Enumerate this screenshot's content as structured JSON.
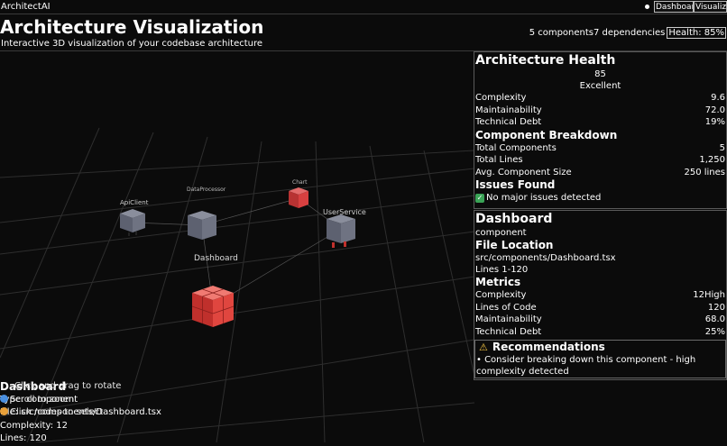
{
  "app": {
    "title": "ArchitectAI"
  },
  "topbar": {
    "dashboard_label": "Dashboard",
    "visualize_label": "Visualize"
  },
  "header": {
    "title": "Architecture Visualization",
    "subtitle": "Interactive 3D visualization of your codebase architecture",
    "components_text": "5 components",
    "dependencies_text": "7 dependencies",
    "health_badge": "Health: 85%"
  },
  "scene": {
    "nodes": [
      {
        "label": "ApiClient",
        "color": "#6f7382"
      },
      {
        "label": "DataProcessor",
        "color": "#6f7382"
      },
      {
        "label": "Chart",
        "color": "#d84040"
      },
      {
        "label": "UserService",
        "color": "#6f7382"
      },
      {
        "label": "Dashboard",
        "color": "#e0463f"
      }
    ]
  },
  "health": {
    "title": "Architecture Health",
    "score": "85",
    "rating": "Excellent",
    "metrics": [
      {
        "label": "Complexity",
        "value": "9.6"
      },
      {
        "label": "Maintainability",
        "value": "72.0"
      },
      {
        "label": "Technical Debt",
        "value": "19%"
      }
    ],
    "breakdown_title": "Component Breakdown",
    "breakdown": [
      {
        "label": "Total Components",
        "value": "5"
      },
      {
        "label": "Total Lines",
        "value": "1,250"
      },
      {
        "label": "Avg. Component Size",
        "value": "250 lines"
      }
    ],
    "issues_title": "Issues Found",
    "issues_text": "No major issues detected"
  },
  "details": {
    "name": "Dashboard",
    "type": "component",
    "location_title": "File Location",
    "path": "src/components/Dashboard.tsx",
    "lines_range": "Lines 1-120",
    "metrics_title": "Metrics",
    "metrics": [
      {
        "label": "Complexity",
        "value": "12High"
      },
      {
        "label": "Lines of Code",
        "value": "120"
      },
      {
        "label": "Maintainability",
        "value": "68.0"
      },
      {
        "label": "Technical Debt",
        "value": "25%"
      }
    ],
    "recommendations_title": "Recommendations",
    "recommendations": [
      "• Consider breaking down this component - high complexity detected"
    ]
  },
  "overlay": {
    "name": "Dashboard",
    "type": "Type: component",
    "file": "File: src/components/Dashboard.tsx",
    "complexity": "Complexity: 12",
    "lines": "Lines: 120"
  },
  "hints": {
    "rotate": "Click and drag to rotate",
    "zoom": "Scroll to zoom",
    "select": "Click nodes to select"
  },
  "colors": {
    "background": "#0b0b0b",
    "selected": "#e0463f",
    "node": "#6f7382",
    "accent_blue": "#4a8fe0",
    "accent_orange": "#e8a03a"
  }
}
